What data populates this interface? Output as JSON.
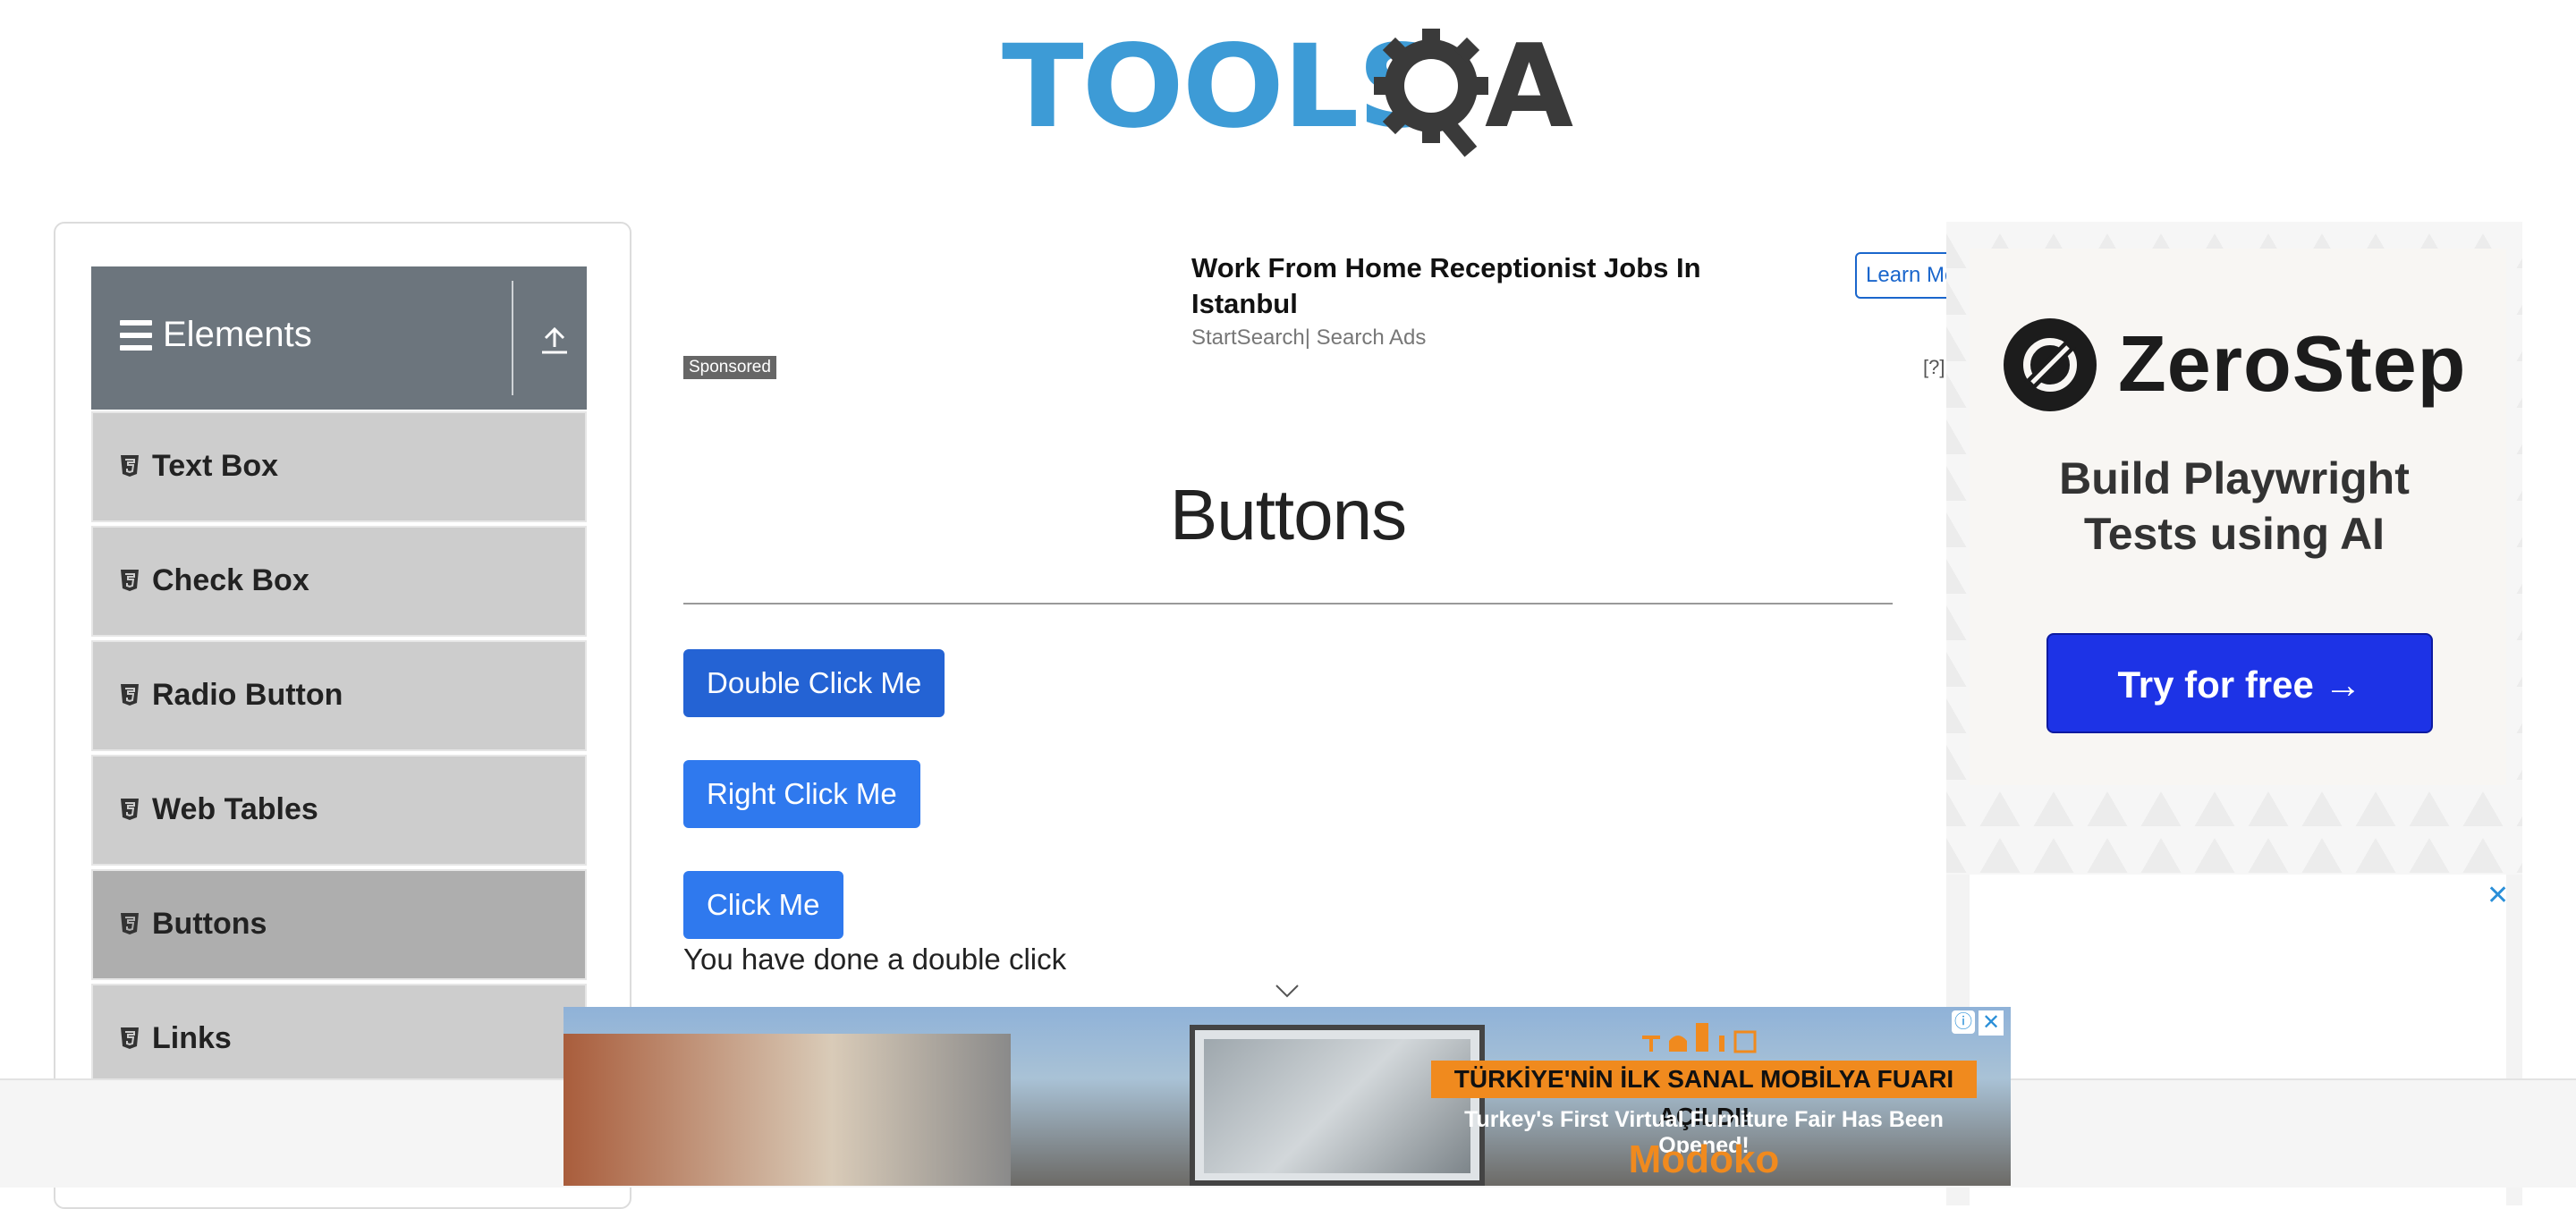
{
  "logo": {
    "part1": "TOOLS",
    "part2": "A"
  },
  "sidebar": {
    "group_title": "Elements",
    "items": [
      {
        "label": "Text Box",
        "active": false
      },
      {
        "label": "Check Box",
        "active": false
      },
      {
        "label": "Radio Button",
        "active": false
      },
      {
        "label": "Web Tables",
        "active": false
      },
      {
        "label": "Buttons",
        "active": true
      },
      {
        "label": "Links",
        "active": false
      }
    ]
  },
  "top_ad": {
    "title": "Work From Home Receptionist Jobs In Istanbul",
    "source": "StartSearch| Search Ads",
    "cta": "Learn More",
    "sponsored": "Sponsored",
    "help": "[?]"
  },
  "main": {
    "title": "Buttons",
    "double_click_label": "Double Click Me",
    "right_click_label": "Right Click Me",
    "click_label": "Click Me",
    "result_message": "You have done a double click"
  },
  "right_ad": {
    "brand": "ZeroStep",
    "tagline_line1": "Build Playwright",
    "tagline_line2": "Tests using AI",
    "cta": "Try for free →",
    "close": "✕"
  },
  "bottom_ad": {
    "banner_tr": "TÜRKİYE'NİN İLK SANAL MOBİLYA FUARI AÇILDI!",
    "banner_en": "Turkey's First Virtual Furniture Fair Has Been Opened!",
    "brand": "Modoko",
    "info": "ⓘ",
    "close": "✕"
  },
  "colors": {
    "accent_blue": "#2f79ee",
    "sidebar_header": "#6c757d",
    "logo_blue": "#3d9bd6",
    "zerostep_cta": "#1d33e6"
  }
}
